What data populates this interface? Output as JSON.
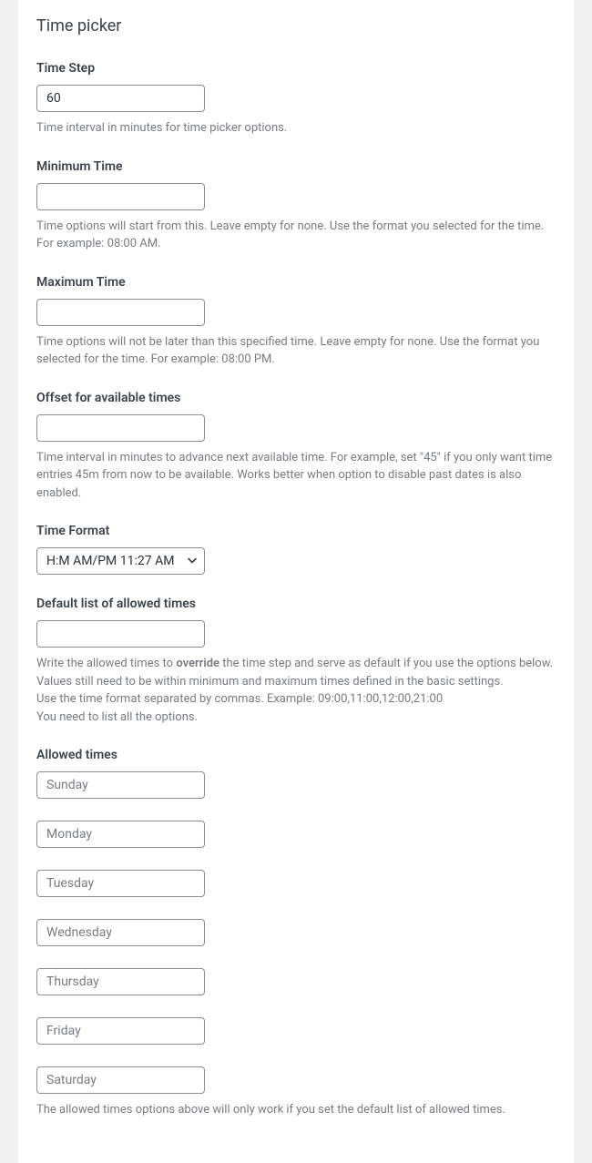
{
  "title": "Time picker",
  "timeStep": {
    "label": "Time Step",
    "value": "60",
    "description": "Time interval in minutes for time picker options."
  },
  "minimumTime": {
    "label": "Minimum Time",
    "value": "",
    "description": "Time options will start from this. Leave empty for none. Use the format you selected for the time. For example: 08:00 AM."
  },
  "maximumTime": {
    "label": "Maximum Time",
    "value": "",
    "description": "Time options will not be later than this specified time. Leave empty for none. Use the format you selected for the time. For example: 08:00 PM."
  },
  "offset": {
    "label": "Offset for available times",
    "value": "",
    "description": "Time interval in minutes to advance next available time. For example, set \"45\" if you only want time entries 45m from now to be available. Works better when option to disable past dates is also enabled."
  },
  "timeFormat": {
    "label": "Time Format",
    "selected": "H:M AM/PM 11:27 AM"
  },
  "defaultAllowed": {
    "label": "Default list of allowed times",
    "value": "",
    "desc1_prefix": "Write the allowed times to ",
    "desc1_strong": "override",
    "desc1_suffix": " the time step and serve as default if you use the options below.",
    "desc2": "Values still need to be within minimum and maximum times defined in the basic settings.",
    "desc3": "Use the time format separated by commas. Example: 09:00,11:00,12:00,21:00",
    "desc4": "You need to list all the options."
  },
  "allowedTimes": {
    "label": "Allowed times",
    "days": [
      "Sunday",
      "Monday",
      "Tuesday",
      "Wednesday",
      "Thursday",
      "Friday",
      "Saturday"
    ],
    "description": "The allowed times options above will only work if you set the default list of allowed times."
  }
}
